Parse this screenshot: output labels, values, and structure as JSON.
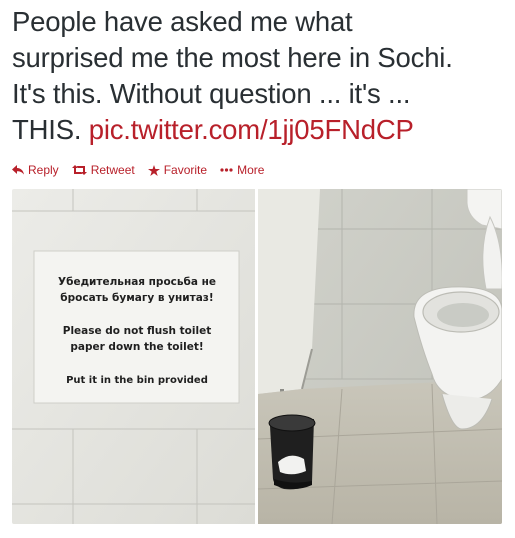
{
  "tweet": {
    "text_line1": "People have asked me what",
    "text_line2": "surprised me the most here in Sochi.",
    "text_line3": "It's this. Without question ... it's ...",
    "text_line4_prefix": "THIS. ",
    "link": "pic.twitter.com/1jj05FNdCP"
  },
  "actions": {
    "reply": "Reply",
    "retweet": "Retweet",
    "favorite": "Favorite",
    "more": "More"
  },
  "icons": {
    "reply": "reply-icon",
    "retweet": "retweet-icon",
    "favorite": "star-icon",
    "more": "more-dots-icon"
  },
  "colors": {
    "link": "#b8202a",
    "text": "#292f33"
  },
  "photo": {
    "sign_line1": "Убедительная просьба не",
    "sign_line2": "бросать бумагу в унитаз!",
    "sign_line3": "Please do not flush toilet",
    "sign_line4": "paper down the toilet!",
    "sign_line5": "Put it in the bin provided"
  }
}
